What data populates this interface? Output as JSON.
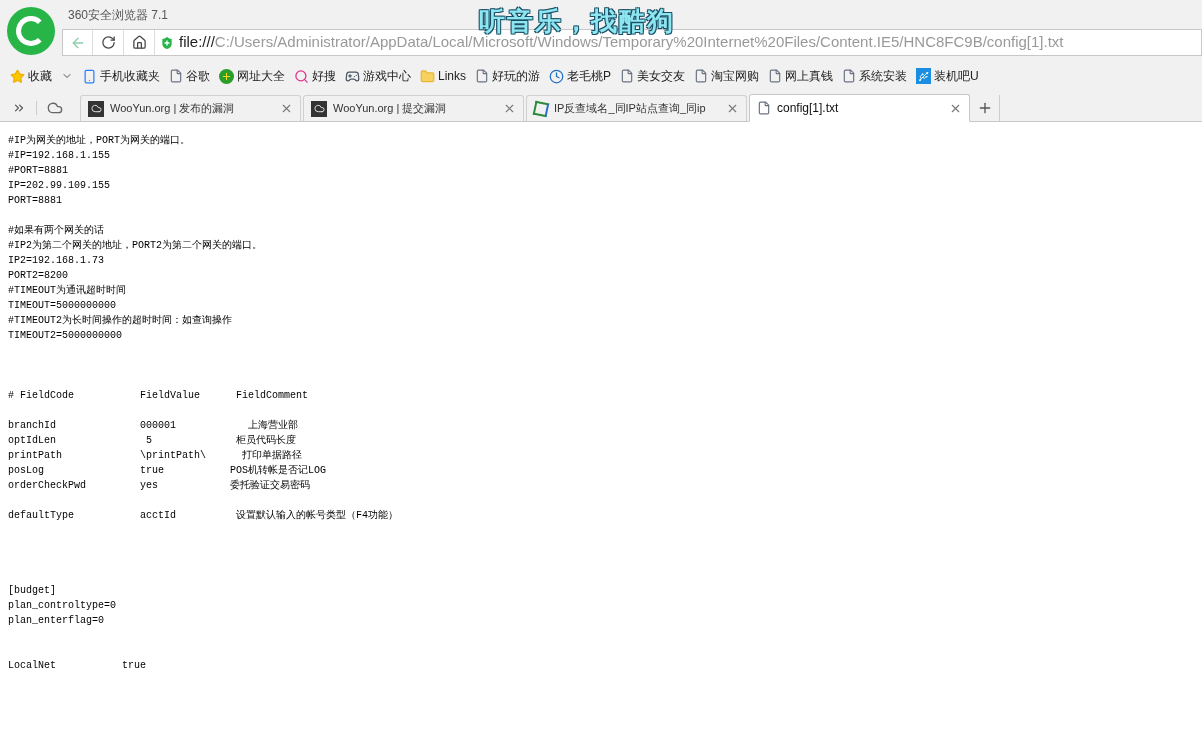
{
  "window": {
    "title": "360安全浏览器 7.1",
    "banner": "听音乐，找酷狗"
  },
  "address_bar": {
    "scheme": "file:///",
    "path": "C:/Users/Administrator/AppData/Local/Microsoft/Windows/Temporary%20Internet%20Files/Content.IE5/HNC8FC9B/config[1].txt"
  },
  "bookmarks": [
    {
      "label": "收藏",
      "kind": "star"
    },
    {
      "label": "手机收藏夹",
      "kind": "phone"
    },
    {
      "label": "谷歌",
      "kind": "page"
    },
    {
      "label": "网址大全",
      "kind": "plus"
    },
    {
      "label": "好搜",
      "kind": "search"
    },
    {
      "label": "游戏中心",
      "kind": "gamepad"
    },
    {
      "label": "Links",
      "kind": "folder"
    },
    {
      "label": "好玩的游",
      "kind": "page"
    },
    {
      "label": "老毛桃P",
      "kind": "clock"
    },
    {
      "label": "美女交友",
      "kind": "page"
    },
    {
      "label": "淘宝网购",
      "kind": "page"
    },
    {
      "label": "网上真钱",
      "kind": "page"
    },
    {
      "label": "系统安装",
      "kind": "page"
    },
    {
      "label": "装机吧U",
      "kind": "usb"
    }
  ],
  "tabs": [
    {
      "label": "WooYun.org | 发布的漏洞",
      "kind": "site",
      "selected": false
    },
    {
      "label": "WooYun.org | 提交漏洞",
      "kind": "site",
      "selected": false
    },
    {
      "label": "IP反查域名_同IP站点查询_同ip",
      "kind": "ip",
      "selected": false
    },
    {
      "label": "config[1].txt",
      "kind": "file",
      "selected": true
    }
  ],
  "file_content": [
    [
      "#IP为网关的地址，PORT为网关的端口。",
      "#IP=192.168.1.155",
      "#PORT=8881",
      "IP=202.99.109.155",
      "PORT=8881"
    ],
    [
      "#如果有两个网关的话",
      "#IP2为第二个网关的地址，PORT2为第二个网关的端口。",
      "IP2=192.168.1.73",
      "PORT2=8200",
      "#TIMEOUT为通讯超时时间",
      "TIMEOUT=5000000000",
      "#TIMEOUT2为长时间操作的超时时间：如查询操作",
      "TIMEOUT2=5000000000"
    ],
    [
      "# FieldCode           FieldValue      FieldComment"
    ],
    [
      "branchId              000001            上海营业部",
      "optIdLen               5              柜员代码长度",
      "printPath             \\printPath\\      打印单据路径",
      "posLog                true           POS机转帐是否记LOG",
      "orderCheckPwd         yes            委托验证交易密码"
    ],
    [
      "defaultType           acctId          设置默认输入的帐号类型（F4功能）"
    ],
    [
      "[budget]",
      "plan_controltype=0",
      "plan_enterflag=0"
    ],
    [
      "LocalNet           true"
    ]
  ]
}
